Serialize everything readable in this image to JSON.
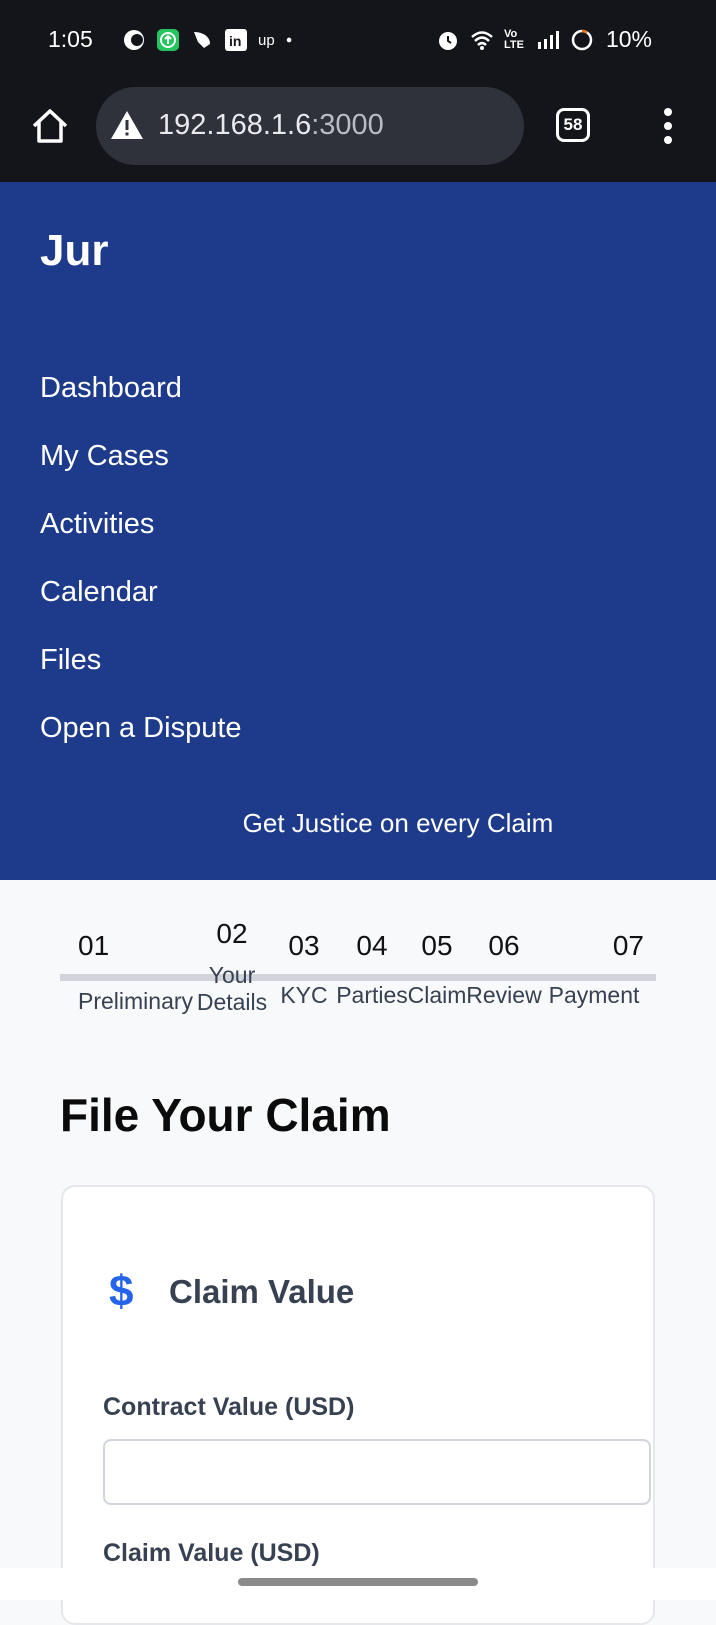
{
  "status_bar": {
    "time": "1:05",
    "left_icons": [
      "cloud-icon",
      "upload-app-icon",
      "bird-app-icon",
      "linkedin-icon",
      "up-icon",
      "dot-icon"
    ],
    "up_text": "up",
    "linkedin_text": "in",
    "network_text": "Vo LTE",
    "battery": "10%",
    "right_icons": [
      "alarm-icon",
      "wifi-icon",
      "volte-icon",
      "signal-icon",
      "battery-icon"
    ]
  },
  "browser": {
    "url_host": "192.168.1.6",
    "url_port": ":3000",
    "tab_count": "58",
    "icons": [
      "home-icon",
      "warning-icon",
      "tabs-icon",
      "more-vert-icon"
    ]
  },
  "nav": {
    "brand": "Jur",
    "items": [
      {
        "label": "Dashboard"
      },
      {
        "label": "My Cases"
      },
      {
        "label": "Activities"
      },
      {
        "label": "Calendar"
      },
      {
        "label": "Files"
      },
      {
        "label": "Open a Dispute"
      }
    ],
    "tagline": "Get Justice on every Claim"
  },
  "stepper": {
    "steps": [
      {
        "num": "01",
        "label": "Preliminary"
      },
      {
        "num": "02",
        "label": "Your Details"
      },
      {
        "num": "03",
        "label": "KYC"
      },
      {
        "num": "04",
        "label": "Parties"
      },
      {
        "num": "05",
        "label": "Claim"
      },
      {
        "num": "06",
        "label": "Review"
      },
      {
        "num": "07",
        "label": "Payment"
      }
    ]
  },
  "main": {
    "title": "File Your Claim",
    "card": {
      "icon": "dollar-icon",
      "icon_glyph": "$",
      "title": "Claim Value",
      "contract_label": "Contract Value (USD)",
      "contract_value": "",
      "claim_label": "Claim Value (USD)"
    }
  },
  "colors": {
    "nav_bg": "#1e3a8a",
    "accent": "#2563eb",
    "chrome_bg": "#14151b"
  }
}
